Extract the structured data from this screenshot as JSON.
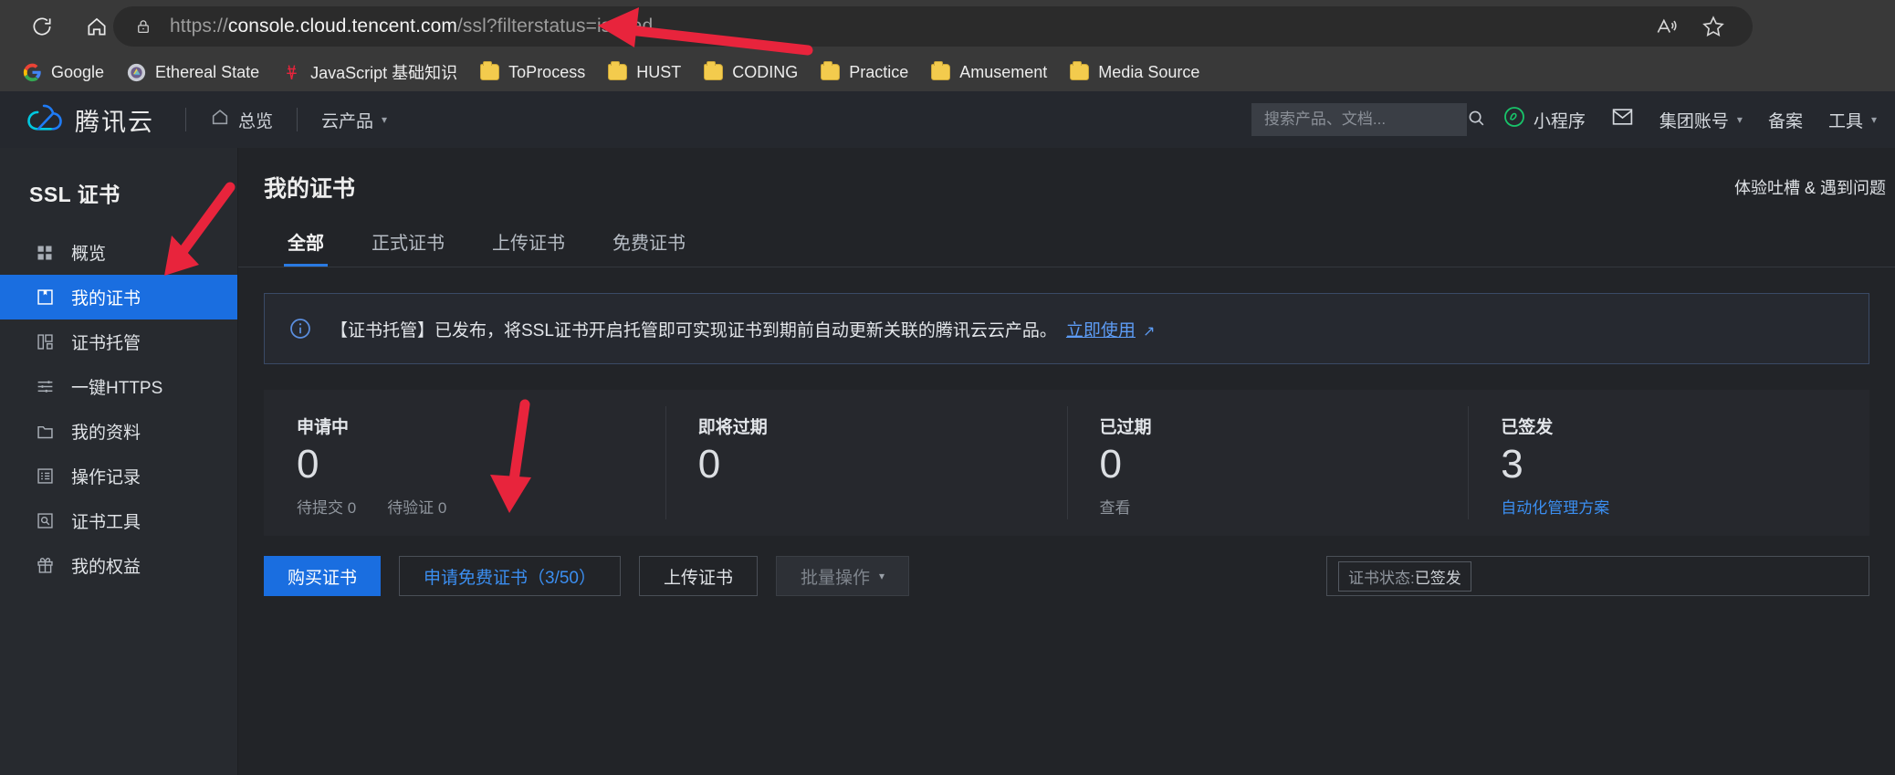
{
  "browser": {
    "reload_icon": "reload-icon",
    "home_icon": "home-icon",
    "lock_icon": "lock-icon",
    "url_scheme": "https://",
    "url_host": "console.cloud.tencent.com",
    "url_path": "/ssl?filterstatus=issued",
    "url_full": "https://console.cloud.tencent.com/ssl?filterstatus=issued",
    "read_aloud_icon": "read-aloud-icon",
    "favorite_icon": "star-icon",
    "bookmarks": [
      {
        "label": "Google",
        "icon": "google-icon"
      },
      {
        "label": "Ethereal State",
        "icon": "ethereal-icon"
      },
      {
        "label": "JavaScript 基础知识",
        "icon": "javascript-tower-icon"
      },
      {
        "label": "ToProcess",
        "icon": "folder-icon"
      },
      {
        "label": "HUST",
        "icon": "folder-icon"
      },
      {
        "label": "CODING",
        "icon": "folder-icon"
      },
      {
        "label": "Practice",
        "icon": "folder-icon"
      },
      {
        "label": "Amusement",
        "icon": "folder-icon"
      },
      {
        "label": "Media Source",
        "icon": "folder-icon"
      }
    ]
  },
  "header": {
    "logo_text": "腾讯云",
    "logo_icon": "tencent-cloud-logo",
    "nav": [
      {
        "label": "总览",
        "icon": "home-icon",
        "caret": false
      },
      {
        "label": "云产品",
        "icon": "",
        "caret": true
      }
    ],
    "search": {
      "placeholder": "搜索产品、文档...",
      "value": "",
      "icon": "search-icon"
    },
    "right_items": [
      {
        "label": "小程序",
        "icon": "miniprogram-icon",
        "caret": false
      },
      {
        "label": "",
        "icon": "mail-icon",
        "caret": false
      },
      {
        "label": "集团账号",
        "icon": "",
        "caret": true
      },
      {
        "label": "备案",
        "icon": "",
        "caret": false
      },
      {
        "label": "工具",
        "icon": "",
        "caret": true
      }
    ]
  },
  "sidebar": {
    "title": "SSL 证书",
    "items": [
      {
        "label": "概览",
        "icon": "grid-icon",
        "active": false
      },
      {
        "label": "我的证书",
        "icon": "certificate-icon",
        "active": true
      },
      {
        "label": "证书托管",
        "icon": "hosting-icon",
        "active": false
      },
      {
        "label": "一键HTTPS",
        "icon": "sliders-icon",
        "active": false
      },
      {
        "label": "我的资料",
        "icon": "folder-icon",
        "active": false
      },
      {
        "label": "操作记录",
        "icon": "list-doc-icon",
        "active": false
      },
      {
        "label": "证书工具",
        "icon": "doc-search-icon",
        "active": false
      },
      {
        "label": "我的权益",
        "icon": "gift-icon",
        "active": false
      }
    ]
  },
  "main": {
    "page_title": "我的证书",
    "header_right": "体验吐槽 & 遇到问题",
    "tabs": [
      {
        "label": "全部",
        "active": true
      },
      {
        "label": "正式证书",
        "active": false
      },
      {
        "label": "上传证书",
        "active": false
      },
      {
        "label": "免费证书",
        "active": false
      }
    ],
    "notice": {
      "icon": "info-icon",
      "text": "【证书托管】已发布，将SSL证书开启托管即可实现证书到期前自动更新关联的腾讯云云产品。",
      "link": "立即使用",
      "link_external_icon": "external-link-icon"
    },
    "stats": [
      {
        "label": "申请中",
        "value": "0",
        "subs": [
          {
            "text": "待提交 0",
            "link": false
          },
          {
            "text": "待验证 0",
            "link": false
          }
        ]
      },
      {
        "label": "即将过期",
        "value": "0",
        "subs": []
      },
      {
        "label": "已过期",
        "value": "0",
        "subs": [
          {
            "text": "查看",
            "link": false
          }
        ]
      },
      {
        "label": "已签发",
        "value": "3",
        "subs": [
          {
            "text": "自动化管理方案",
            "link": true
          }
        ]
      }
    ],
    "actions": [
      {
        "label": "购买证书",
        "style": "primary"
      },
      {
        "label": "申请免费证书（3/50）",
        "style": "outline"
      },
      {
        "label": "上传证书",
        "style": "ghost"
      },
      {
        "label": "批量操作",
        "style": "disabled",
        "caret": true
      }
    ],
    "filter": {
      "tag_key": "证书状态:",
      "tag_value": "已签发"
    }
  },
  "annotations": {
    "arrow_url_color": "#e8243c",
    "arrow_sidebar_color": "#e8243c",
    "arrow_button_color": "#e8243c"
  }
}
